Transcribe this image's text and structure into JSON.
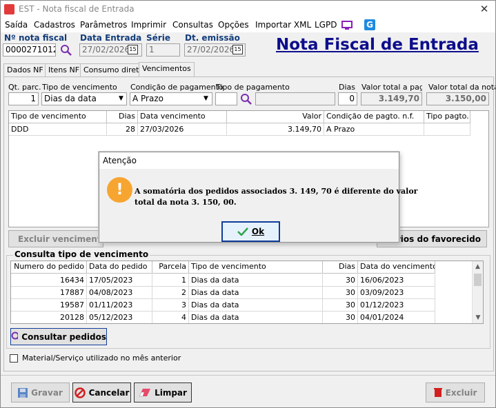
{
  "window": {
    "title": "EST - Nota fiscal de Entrada"
  },
  "menu": [
    {
      "label": "Saída"
    },
    {
      "label": "Cadastros"
    },
    {
      "label": "Parâmetros"
    },
    {
      "label": "Imprimir"
    },
    {
      "label": "Consultas"
    },
    {
      "label": "Opções"
    },
    {
      "label": "Importar XML"
    },
    {
      "label": "LGPD"
    }
  ],
  "header": {
    "nota_label": "Nº nota fiscal",
    "nota_value": "0000271012",
    "data_entrada_label": "Data Entrada",
    "data_entrada_value": "27/02/2026",
    "serie_label": "Série",
    "serie_value": "1",
    "dt_emissao_label": "Dt. emissão",
    "dt_emissao_value": "27/02/2026",
    "page_title": "Nota Fiscal de Entrada",
    "calendar_glyph": "15"
  },
  "tabs": [
    {
      "label": "Dados NF"
    },
    {
      "label": "Itens NF"
    },
    {
      "label": "Consumo direto"
    },
    {
      "label": "Vencimentos"
    }
  ],
  "form": {
    "qt_parc_label": "Qt. parc.",
    "qt_parc_value": "1",
    "tipo_venc_label": "Tipo de vencimento",
    "tipo_venc_value": "Dias da data",
    "cond_pag_label": "Condição de pagamento",
    "cond_pag_value": "A Prazo",
    "tipo_pag_label": "Tipo de pagamento",
    "tipo_pag_value": "",
    "dias_label": "Dias",
    "dias_value": "0",
    "valor_pagar_label": "Valor total a pagar",
    "valor_pagar_value": "3.149,70",
    "valor_nota_label": "Valor total da nota",
    "valor_nota_value": "3.150,00"
  },
  "venc_grid": {
    "columns": [
      "Tipo de vencimento",
      "Dias",
      "Data vencimento",
      "Valor",
      "Condição de pagto. n.f.",
      "Tipo pagto."
    ],
    "rows": [
      {
        "tipo": "DDD",
        "dias": "28",
        "data": "27/03/2026",
        "valor": "3.149,70",
        "cond": "A Prazo",
        "tipo_pagto": ""
      }
    ]
  },
  "buttons": {
    "excluir_vencimento": "Excluir vencimento",
    "dados_bancarios": "cários do favorecido",
    "consultar_pedidos": "Consultar pedidos",
    "gravar": "Gravar",
    "cancelar": "Cancelar",
    "limpar": "Limpar",
    "excluir": "Excluir"
  },
  "consulta": {
    "title": "Consulta tipo de vencimento",
    "columns": [
      "Numero do pedido",
      "Data do pedido",
      "Parcela",
      "Tipo de vencimento",
      "Dias",
      "Data do vencimento"
    ],
    "rows": [
      {
        "numero": "16434",
        "data": "17/05/2023",
        "parcela": "1",
        "tipo": "Dias da data",
        "dias": "30",
        "venc": "16/06/2023"
      },
      {
        "numero": "17887",
        "data": "04/08/2023",
        "parcela": "2",
        "tipo": "Dias da data",
        "dias": "30",
        "venc": "03/09/2023"
      },
      {
        "numero": "19587",
        "data": "01/11/2023",
        "parcela": "3",
        "tipo": "Dias da data",
        "dias": "30",
        "venc": "01/12/2023"
      },
      {
        "numero": "20128",
        "data": "05/12/2023",
        "parcela": "4",
        "tipo": "Dias da data",
        "dias": "30",
        "venc": "04/01/2024"
      }
    ]
  },
  "checkbox": {
    "label": "Material/Serviço utilizado no mês anterior",
    "checked": false
  },
  "dialog": {
    "title": "Atenção",
    "message_line1": "A somatória dos pedidos associados 3. 149, 70 é diferente do valor",
    "message_line2": "total da nota 3. 150, 00.",
    "ok_label": "Ok"
  },
  "colors": {
    "title_blue": "#0d0d8c",
    "label_blue": "#123c7a",
    "warning_orange": "#f7a531"
  }
}
